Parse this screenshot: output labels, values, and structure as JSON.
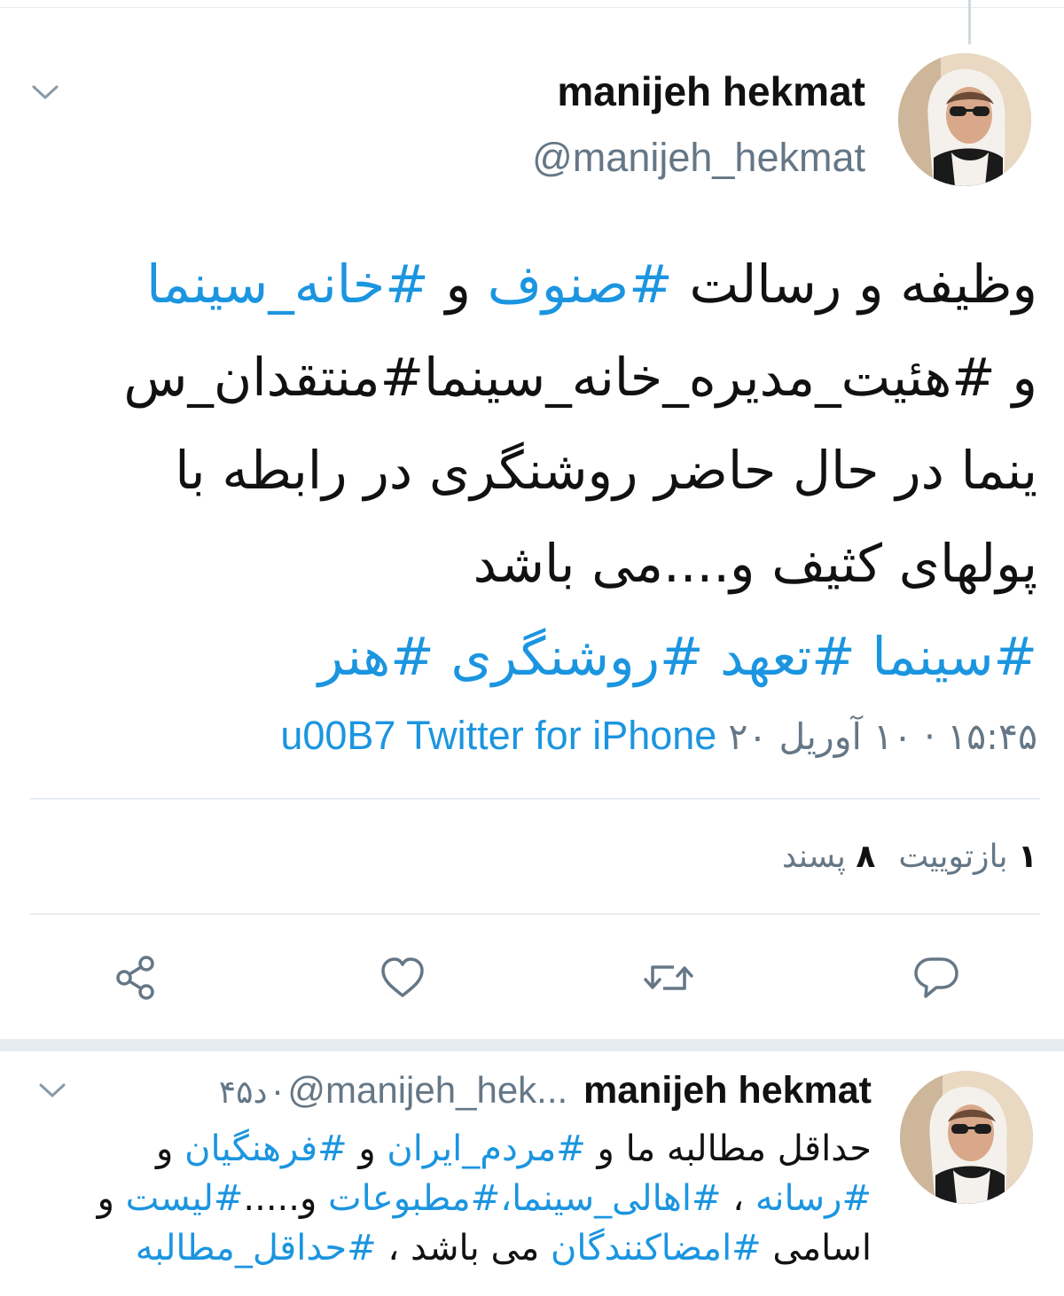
{
  "main_tweet": {
    "name": "manijeh hekmat",
    "handle": "@manijeh_hekmat",
    "text_lines": [
      [
        {
          "t": "وظیفه و رسالت ",
          "h": false
        },
        {
          "t": "#صنوف",
          "h": true
        },
        {
          "t": " و ",
          "h": false
        },
        {
          "t": "#خانه_سینما",
          "h": true
        }
      ],
      [
        {
          "t": "و #هئیت_مدیره_خانه_سینما#منتقدان_س",
          "h": false
        }
      ],
      [
        {
          "t": "ینما در  حال حاضر روشنگری در رابطه با",
          "h": false
        }
      ],
      [
        {
          "t": "پولهای کثیف و....می باشد",
          "h": false
        }
      ]
    ],
    "hashtags_line": "#سینما #تعهد #روشنگری #هنر",
    "timestamp": "۱۵:۴۵ · ۱۰ آوریل ۲۰",
    "source": "Twitter for iPhone",
    "source_code": "u00B7",
    "retweets_count": "۱",
    "retweets_label": "بازتوییت",
    "likes_count": "۸",
    "likes_label": "پسند"
  },
  "actions": {
    "reply_icon": "comment-icon",
    "retweet_icon": "retweet-icon",
    "like_icon": "heart-icon",
    "share_icon": "share-icon"
  },
  "reply_tweet": {
    "name": "manijeh hekmat",
    "handle": "@manijeh_hek...",
    "separator": "·",
    "time": "۴۵د",
    "text_lines": [
      [
        {
          "t": "حداقل مطالبه ما و ",
          "h": false
        },
        {
          "t": "#مردم_ایران",
          "h": true
        },
        {
          "t": "  و ",
          "h": false
        },
        {
          "t": "#فرهنگیان",
          "h": true
        },
        {
          "t": " و",
          "h": false
        }
      ],
      [
        {
          "t": "#رسانه",
          "h": true
        },
        {
          "t": " ، ",
          "h": false
        },
        {
          "t": "#اهالی_سینما،#مطبوعات",
          "h": true
        },
        {
          "t": " و.....",
          "h": false
        },
        {
          "t": "#لیست",
          "h": true
        },
        {
          "t": " و",
          "h": false
        }
      ],
      [
        {
          "t": "اسامی ",
          "h": false
        },
        {
          "t": "#امضاکنندگان",
          "h": true
        },
        {
          "t": " می باشد ، ",
          "h": false
        },
        {
          "t": "#حداقل_مطالبه",
          "h": true
        }
      ]
    ]
  },
  "colors": {
    "link": "#1b95e0",
    "secondary": "#657786",
    "text": "#111111",
    "divider": "#e6ecf0"
  }
}
